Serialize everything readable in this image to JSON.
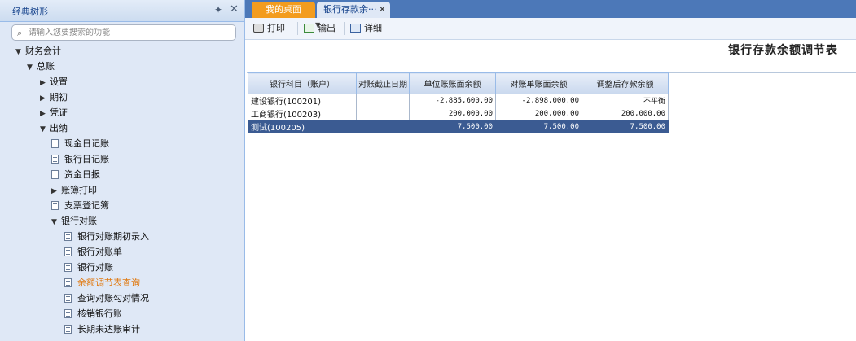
{
  "left_panel": {
    "title": "经典树形",
    "pin_icon": "pin-icon",
    "close_icon": "close-icon",
    "search_placeholder": "请输入您要搜索的功能"
  },
  "tree": [
    {
      "label": "财务会计",
      "level": 0,
      "type": "expanded"
    },
    {
      "label": "总账",
      "level": 1,
      "type": "expanded"
    },
    {
      "label": "设置",
      "level": 2,
      "type": "collapsed"
    },
    {
      "label": "期初",
      "level": 2,
      "type": "collapsed"
    },
    {
      "label": "凭证",
      "level": 2,
      "type": "collapsed"
    },
    {
      "label": "出纳",
      "level": 2,
      "type": "expanded"
    },
    {
      "label": "现金日记账",
      "level": 3,
      "type": "leaf"
    },
    {
      "label": "银行日记账",
      "level": 3,
      "type": "leaf"
    },
    {
      "label": "资金日报",
      "level": 3,
      "type": "leaf"
    },
    {
      "label": "账簿打印",
      "level": 3,
      "type": "collapsed"
    },
    {
      "label": "支票登记簿",
      "level": 3,
      "type": "leaf"
    },
    {
      "label": "银行对账",
      "level": 3,
      "type": "expanded"
    },
    {
      "label": "银行对账期初录入",
      "level": 4,
      "type": "leaf"
    },
    {
      "label": "银行对账单",
      "level": 4,
      "type": "leaf"
    },
    {
      "label": "银行对账",
      "level": 4,
      "type": "leaf"
    },
    {
      "label": "余额调节表查询",
      "level": 4,
      "type": "leaf",
      "selected": true
    },
    {
      "label": "查询对账勾对情况",
      "level": 4,
      "type": "leaf"
    },
    {
      "label": "核销银行账",
      "level": 4,
      "type": "leaf"
    },
    {
      "label": "长期未达账审计",
      "level": 4,
      "type": "leaf"
    }
  ],
  "tabs": [
    {
      "label": "我的桌面",
      "active": false
    },
    {
      "label": "银行存款余···",
      "active": true
    }
  ],
  "toolbar": {
    "print_label": "打印",
    "export_label": "输出",
    "detail_label": "详细"
  },
  "report": {
    "title": "银行存款余额调节表",
    "columns": [
      "银行科目（账户）",
      "对账截止日期",
      "单位账账面余额",
      "对账单账面余额",
      "调整后存款余额"
    ],
    "rows": [
      [
        "建设银行(100201)",
        "",
        "-2,885,600.00",
        "-2,898,000.00",
        "不平衡"
      ],
      [
        "工商银行(100203)",
        "",
        "200,000.00",
        "200,000.00",
        "200,000.00"
      ],
      [
        "测试(100205)",
        "",
        "7,500.00",
        "7,500.00",
        "7,500.00"
      ]
    ],
    "selected_row": 2
  },
  "colors": {
    "tab_active_desktop": "#f39c1e",
    "tabbar_bg": "#4c78b8",
    "selected_row": "#3b5b92",
    "selected_tree_text": "#e07a12"
  }
}
